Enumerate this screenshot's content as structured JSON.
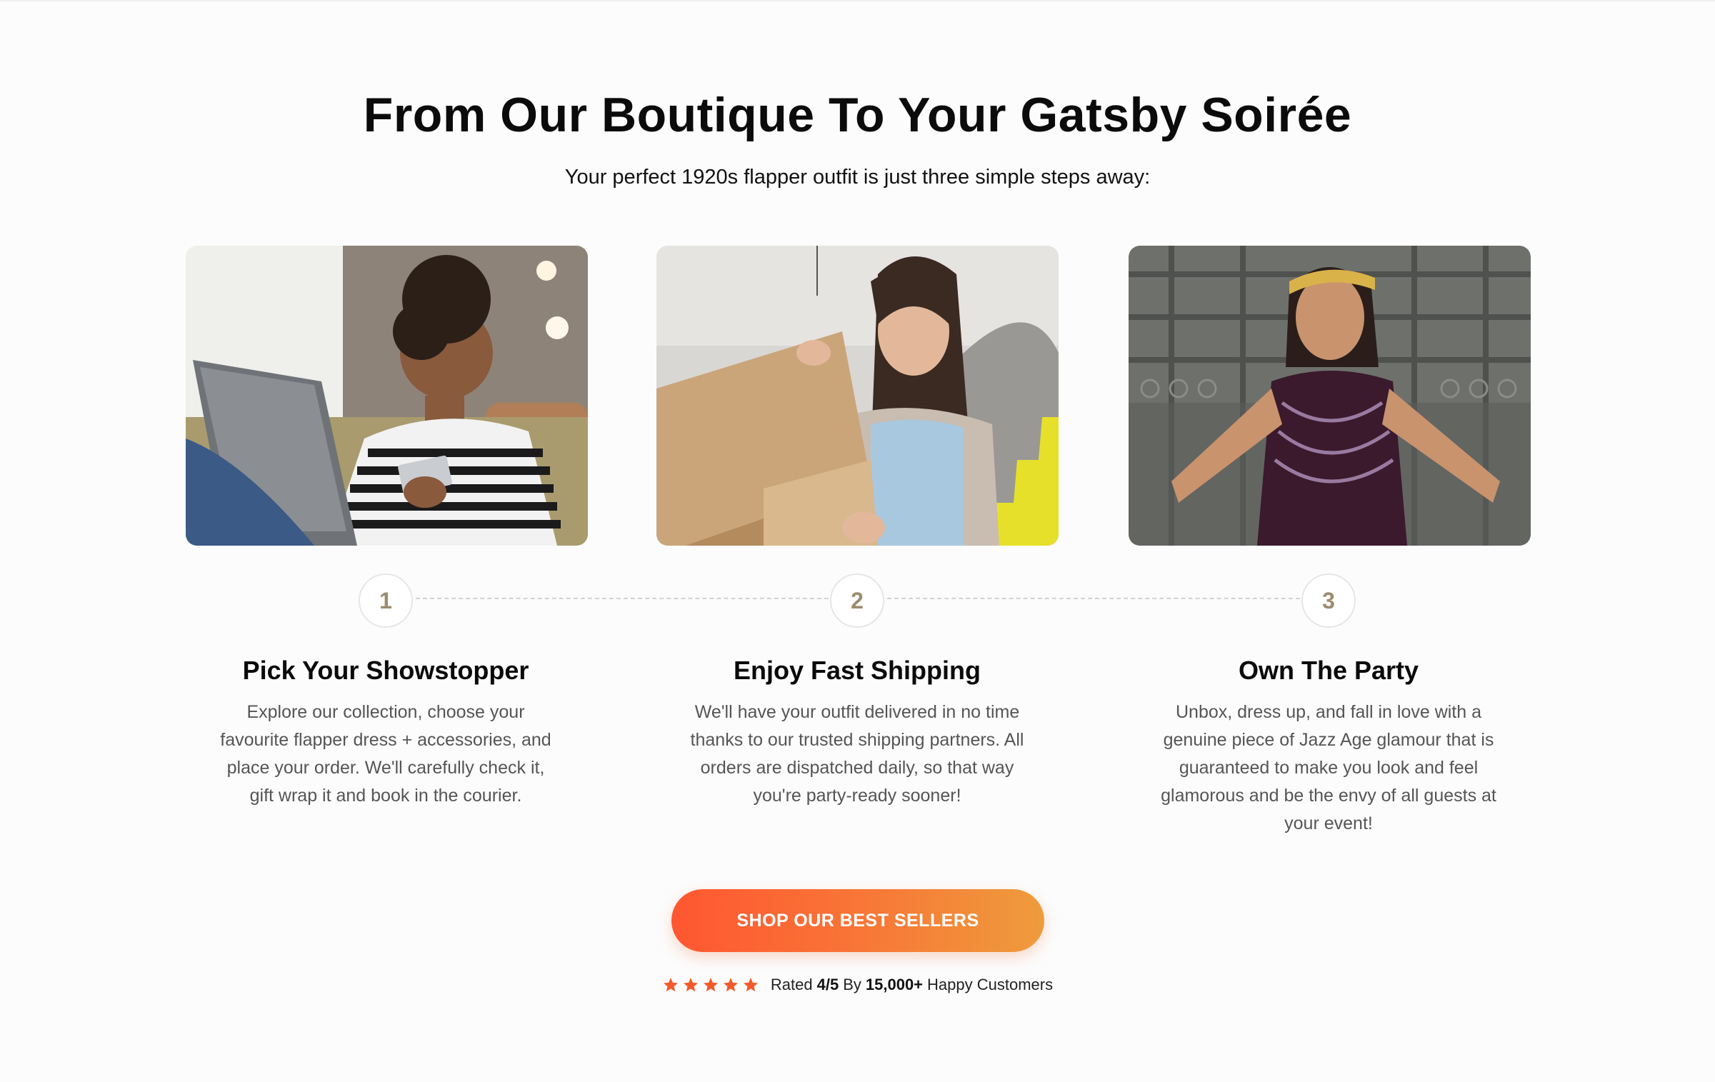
{
  "header": {
    "title": "From Our Boutique To Your Gatsby Soirée",
    "subtitle": "Your perfect 1920s flapper outfit is just three simple steps away:"
  },
  "steps": [
    {
      "number": "1",
      "title": "Pick Your Showstopper",
      "description": "Explore our collection, choose your favourite flapper dress + accessories, and place your order. We'll carefully check it, gift wrap it and book in the courier.",
      "image": "woman-shopping-online-with-card-photo"
    },
    {
      "number": "2",
      "title": "Enjoy Fast Shipping",
      "description": "We'll have your outfit delivered in no time thanks to our trusted shipping partners. All orders are dispatched daily, so that way you're party-ready sooner!",
      "image": "woman-opening-cardboard-box-photo"
    },
    {
      "number": "3",
      "title": "Own The Party",
      "description": "Unbox, dress up, and fall in love with a genuine piece of Jazz Age glamour that is guaranteed to make you look and feel glamorous and be the envy of all guests at your event!",
      "image": "woman-in-sequin-flapper-dress-photo"
    }
  ],
  "cta": {
    "label": "SHOP OUR BEST SELLERS"
  },
  "rating": {
    "stars": 5,
    "rated_prefix": "Rated",
    "score": "4/5",
    "by_text": "By",
    "count": "15,000+",
    "suffix": "Happy Customers"
  },
  "colors": {
    "accent_start": "#ff5631",
    "accent_end": "#ee9c3c",
    "step_number": "#9b8c6e",
    "star": "#f15a2b"
  }
}
